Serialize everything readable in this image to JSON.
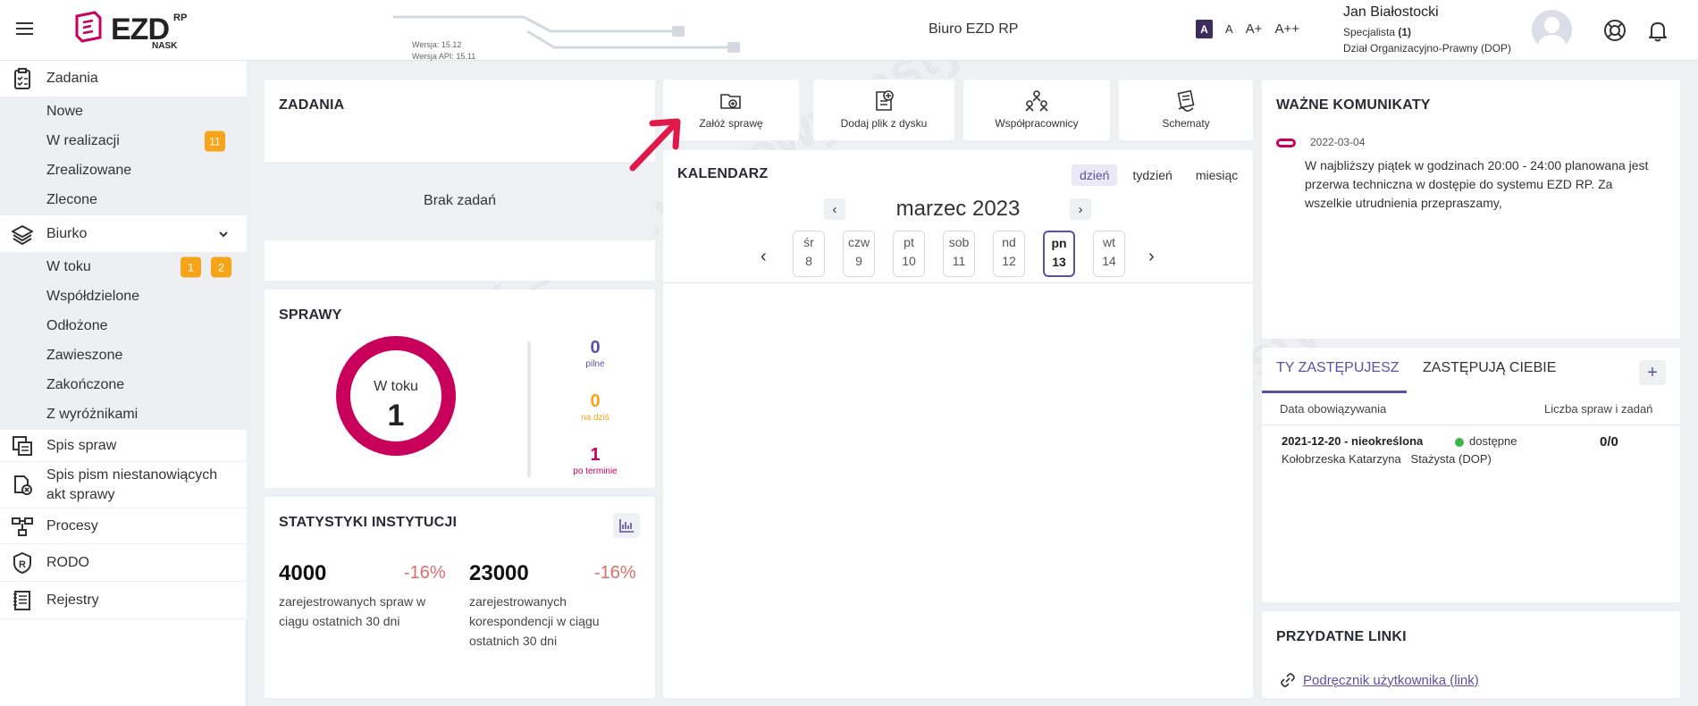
{
  "header": {
    "logo_text": "EZD",
    "logo_sup": "RP",
    "logo_sub": "NASK",
    "version": "Wersja: 15.12",
    "api_version": "Wersja API: 15.11",
    "office": "Biuro EZD RP",
    "font_sizes": [
      "A",
      "A",
      "A+",
      "A++"
    ],
    "user_name": "Jan Białostocki",
    "user_role_prefix": "Specjalista ",
    "user_role_count": "(1)",
    "user_dept": "Dział Organizacyjno-Prawny (DOP)"
  },
  "sidebar": {
    "zadania": "Zadania",
    "nowe": "Nowe",
    "w_realizacji": "W realizacji",
    "w_realizacji_badge": "11",
    "zrealizowane": "Zrealizowane",
    "zlecone": "Zlecone",
    "biurko": "Biurko",
    "w_toku": "W toku",
    "w_toku_badge_1": "1",
    "w_toku_badge_2": "2",
    "wspoldzielone": "Współdzielone",
    "odlozone": "Odłożone",
    "zawieszone": "Zawieszone",
    "zakonczone": "Zakończone",
    "z_wyroznikami": "Z wyróżnikami",
    "spis_spraw": "Spis spraw",
    "spis_pism_1": "Spis pism niestanowiących",
    "spis_pism_2": "akt sprawy",
    "procesy": "Procesy",
    "rodo": "RODO",
    "rejestry": "Rejestry"
  },
  "zadania": {
    "title": "ZADANIA",
    "empty": "Brak zadań"
  },
  "sprawy": {
    "title": "SPRAWY",
    "donut_label": "W toku",
    "donut_value": "1",
    "pilne_value": "0",
    "pilne_label": "pilne",
    "nadzis_value": "0",
    "nadzis_label": "na dziś",
    "poterminie_value": "1",
    "poterminie_label": "po terminie"
  },
  "statystyki": {
    "title": "STATYSTYKI INSTYTUCJI",
    "a_value": "4000",
    "a_pct": "-16%",
    "a_desc_1": "zarejestrowanych spraw w",
    "a_desc_2": "ciągu ostatnich 30 dni",
    "b_value": "23000",
    "b_pct": "-16%",
    "b_desc_1": "zarejestrowanych",
    "b_desc_2": "korespondencji w ciągu",
    "b_desc_3": "ostatnich 30 dni"
  },
  "actions": {
    "zaloz": "Załóż sprawę",
    "dodaj": "Dodaj plik z dysku",
    "wspolpracownicy": "Współpracownicy",
    "schematy": "Schematy"
  },
  "kalendarz": {
    "title": "KALENDARZ",
    "view_day": "dzień",
    "view_week": "tydzień",
    "view_month": "miesiąc",
    "month": "marzec 2023",
    "days": [
      {
        "name": "śr",
        "num": "8"
      },
      {
        "name": "czw",
        "num": "9"
      },
      {
        "name": "pt",
        "num": "10"
      },
      {
        "name": "sob",
        "num": "11"
      },
      {
        "name": "nd",
        "num": "12"
      },
      {
        "name": "pn",
        "num": "13"
      },
      {
        "name": "wt",
        "num": "14"
      }
    ]
  },
  "komunikaty": {
    "title": "WAŻNE KOMUNIKATY",
    "date": "2022-03-04",
    "text": "W najbliższy piątek w godzinach 20:00 - 24:00 planowana jest przerwa techniczna w dostępie do systemu EZD RP. Za wszelkie utrudnienia przepraszamy,"
  },
  "zastepstwa": {
    "tab_active": "TY ZASTĘPUJESZ",
    "tab_other": "ZASTĘPUJĄ CIEBIE",
    "plus": "+",
    "col_date": "Data obowiązywania",
    "col_count": "Liczba spraw i zadań",
    "row_period": "2021-12-20 - nieokreślona",
    "row_status": "dostępne",
    "row_person": "Kołobrzeska Katarzyna   Stażysta (DOP)",
    "row_count": "0/0"
  },
  "linki": {
    "title": "PRZYDATNE LINKI",
    "link": "Podręcznik użytkownika (link)"
  },
  "colors": {
    "accent": "#5e4fa2",
    "brand": "#c8005c",
    "badge": "#f6a51a",
    "pilne": "#5e4fa2",
    "nadzis": "#f6a51a",
    "poterminie": "#c8005c",
    "negative": "#e06c6c"
  },
  "icons": [
    "menu-icon",
    "tasks-icon",
    "layers-icon",
    "cases-list-icon",
    "documents-icon",
    "processes-icon",
    "rodo-shield-icon",
    "registers-icon",
    "folder-icon",
    "file-add-icon",
    "people-icon",
    "schema-icon",
    "chart-icon",
    "link-icon",
    "support-icon",
    "bell-icon"
  ]
}
